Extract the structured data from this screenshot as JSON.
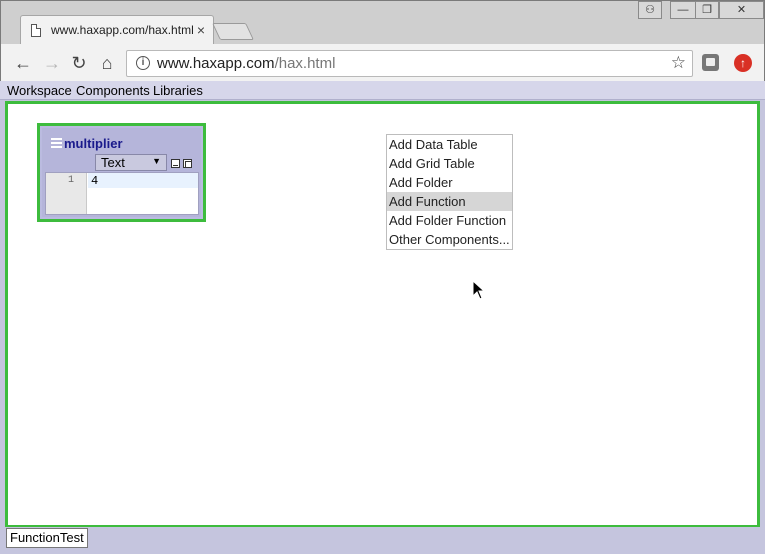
{
  "browser": {
    "tab_title": "www.haxapp.com/hax.html",
    "tab_close": "×",
    "url_host": "www.haxapp.com",
    "url_path": "/hax.html",
    "window_buttons": {
      "user": "⚇",
      "minimize": "—",
      "restore": "❐",
      "close": "✕"
    },
    "nav": {
      "back": "←",
      "forward": "→",
      "reload": "↻",
      "home": "⌂"
    },
    "star": "☆",
    "info": "i",
    "ext2_label": "↑"
  },
  "menubar": {
    "items": [
      "Workspace",
      "Components",
      "Libraries"
    ]
  },
  "component": {
    "title": "multiplier",
    "view_select": "Text",
    "select_arrow": "▼",
    "line_number": "1",
    "code": "4"
  },
  "context_menu": {
    "items": [
      "Add Data Table",
      "Add Grid Table",
      "Add Folder",
      "Add Function",
      "Add Folder Function",
      "Other Components..."
    ],
    "hovered_index": 3
  },
  "status": {
    "tab_label": "FunctionTest"
  },
  "colors": {
    "selection_border": "#3dbc3d",
    "app_background": "#c5c5de",
    "component_title": "#1a1a8c"
  }
}
